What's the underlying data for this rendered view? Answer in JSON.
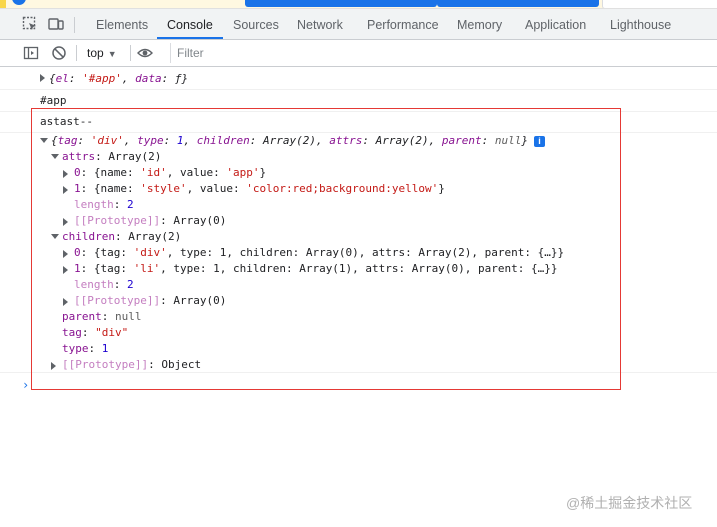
{
  "tabs": [
    "Elements",
    "Console",
    "Sources",
    "Network",
    "Performance",
    "Memory",
    "Application",
    "Lighthouse"
  ],
  "active_tab": "Console",
  "console_toolbar": {
    "context": "top",
    "filter_placeholder": "Filter"
  },
  "console": {
    "line1": {
      "open": "{",
      "k1": "el",
      "sep1": ": ",
      "v1": "'#app'",
      "comma": ", ",
      "k2": "data",
      "sep2": ": ",
      "v2": "ƒ",
      "close": "}"
    },
    "line2": "#app",
    "line3": "astast--",
    "tree": {
      "summary": {
        "p1": "{",
        "tag_k": "tag",
        "tag_v": "'div'",
        "type_k": "type",
        "type_v": "1",
        "children_k": "children",
        "children_v": "Array(2)",
        "attrs_k": "attrs",
        "attrs_v": "Array(2)",
        "parent_k": "parent",
        "parent_v": "null",
        "close": "}",
        "badge": "i"
      },
      "attrs_label": "attrs",
      "attrs_value": "Array(2)",
      "attr0": {
        "idx": "0",
        "open": "{name: ",
        "name": "'id'",
        "mid": ", value: ",
        "value": "'app'",
        "close": "}"
      },
      "attr1": {
        "idx": "1",
        "open": "{name: ",
        "name": "'style'",
        "mid": ", value: ",
        "value": "'color:red;background:yellow'",
        "close": "}"
      },
      "attrs_length_k": "length",
      "attrs_length_v": "2",
      "attrs_proto_k": "[[Prototype]]",
      "attrs_proto_v": "Array(0)",
      "children_label": "children",
      "children_value": "Array(2)",
      "child0": {
        "idx": "0",
        "open": "{tag: ",
        "tag": "'div'",
        "rest": ", type: 1, children: Array(0), attrs: Array(2), parent: {…}}"
      },
      "child1": {
        "idx": "1",
        "open": "{tag: ",
        "tag": "'li'",
        "rest": ", type: 1, children: Array(1), attrs: Array(0), parent: {…}}"
      },
      "children_length_k": "length",
      "children_length_v": "2",
      "children_proto_k": "[[Prototype]]",
      "children_proto_v": "Array(0)",
      "parent_k": "parent",
      "parent_v": "null",
      "tag_k": "tag",
      "tag_v": "\"div\"",
      "type_k": "type",
      "type_v": "1",
      "proto_k": "[[Prototype]]",
      "proto_v": "Object"
    },
    "prompt": "›"
  },
  "watermark": "@稀土掘金技术社区",
  "colors": {
    "accent": "#1a73e8",
    "highlight_box": "#e53935"
  }
}
